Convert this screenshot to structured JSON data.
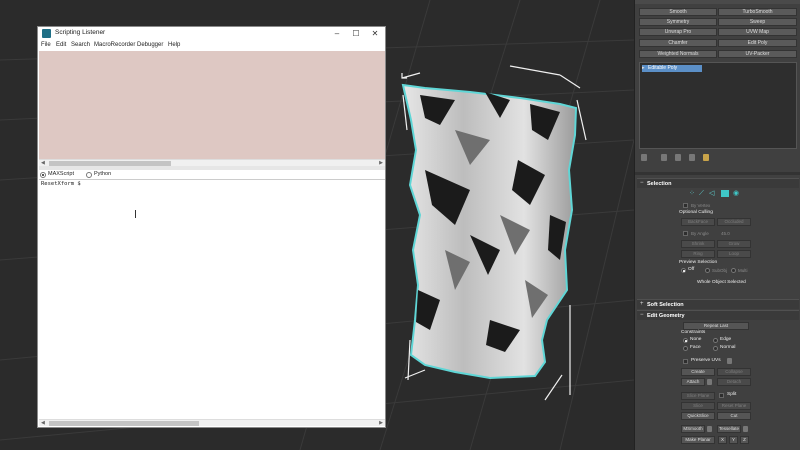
{
  "listener": {
    "title": "Scripting Listener",
    "controls": {
      "minimize": "–",
      "maximize": "☐",
      "close": "✕"
    },
    "menu": [
      "File",
      "Edit",
      "Search",
      "MacroRecorder",
      "Debugger",
      "Help"
    ],
    "languages": [
      {
        "label": "MAXScript",
        "selected": true
      },
      {
        "label": "Python",
        "selected": false
      }
    ],
    "output_text": "ResetXform $"
  },
  "modifier_buttons": [
    [
      "Smooth",
      "TurboSmooth"
    ],
    [
      "Symmetry",
      "Sweep"
    ],
    [
      "Unwrap Pro",
      "UVW Map"
    ],
    [
      "Chamfer",
      "Edit Poly"
    ],
    [
      "Weighted Normals",
      "UV-Packer"
    ]
  ],
  "stack": {
    "item": "Editable Poly"
  },
  "selection": {
    "title": "Selection",
    "sign": "−",
    "by_vertex": "By Vertex",
    "optional_culling": "Optional Culling",
    "backface": "BackFace",
    "occluded": "Occluded",
    "by_angle": "By Angle",
    "angle_value": "45.0",
    "shrink": "Shrink",
    "grow": "Grow",
    "ring": "Ring",
    "loop": "Loop",
    "preview_selection": "Preview Selection",
    "off": "Off",
    "subobj": "SubObj",
    "multi": "Multi",
    "status": "Whole Object Selected"
  },
  "soft_selection": {
    "title": "Soft Selection",
    "sign": "+"
  },
  "edit_geometry": {
    "title": "Edit Geometry",
    "sign": "−",
    "repeat_last": "Repeat Last",
    "constraints": "Constraints",
    "none": "None",
    "edge": "Edge",
    "face": "Face",
    "normal": "Normal",
    "preserve_uvs": "Preserve UVs",
    "create": "Create",
    "collapse": "Collapse",
    "attach": "Attach",
    "detach": "Detach",
    "slice_plane": "Slice Plane",
    "split": "Split",
    "slice": "Slice",
    "reset_plane": "Reset Plane",
    "quickslice": "QuickSlice",
    "cut": "Cut",
    "msmooth": "MSmooth",
    "tessellate": "Tessellate",
    "make_planar": "Make Planar",
    "x": "X",
    "y": "Y",
    "z": "Z"
  },
  "colors": {
    "viewport_bg": "#2b2b2b",
    "macro_pane_bg": "#dec8c3",
    "selection_outline": "#5fd6d6",
    "panel_bg": "#404040",
    "stack_highlight": "#5b8fc7"
  }
}
